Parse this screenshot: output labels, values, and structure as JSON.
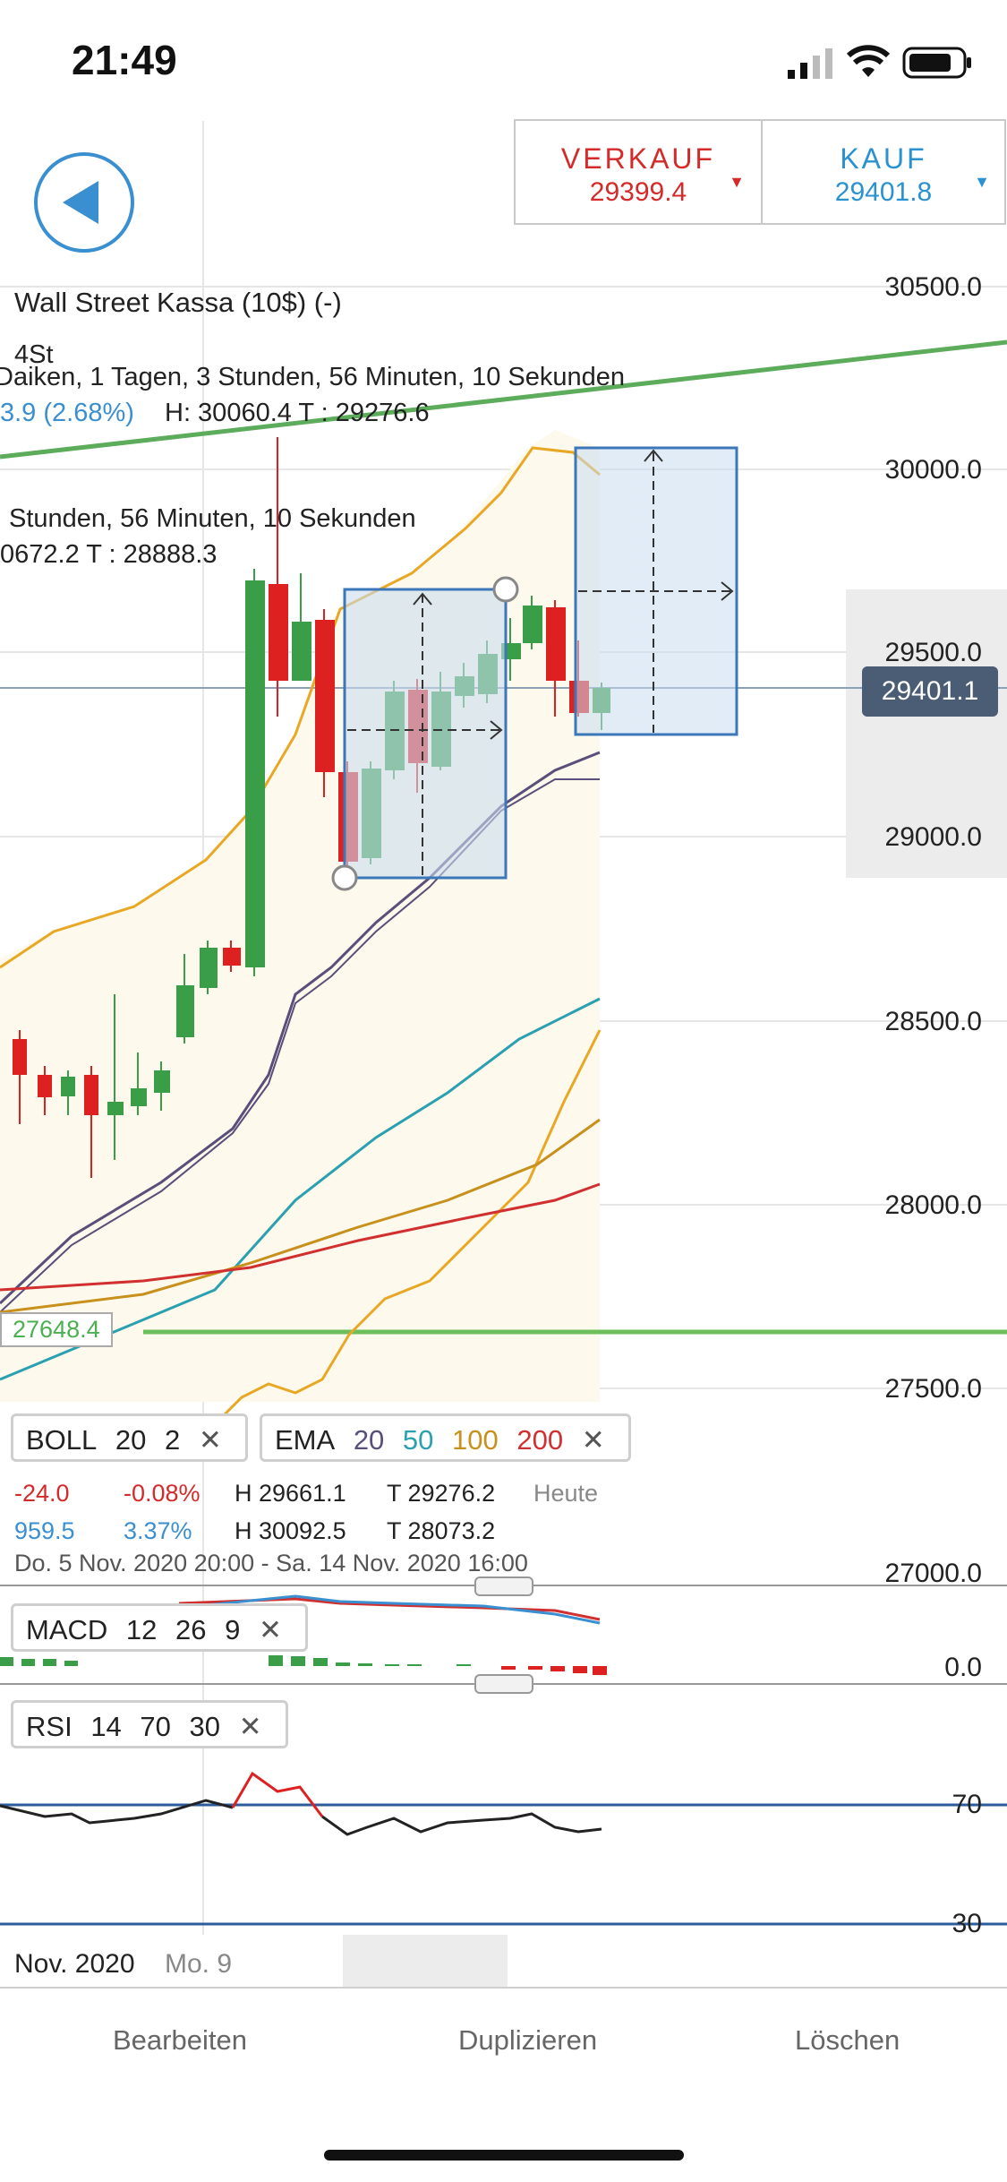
{
  "status": {
    "time": "21:49"
  },
  "trade": {
    "sell_label": "VERKAUF",
    "sell_price": "29399.4",
    "buy_label": "KAUF",
    "buy_price": "29401.8"
  },
  "instrument": {
    "name": "Wall Street Kassa (10$) (-)",
    "timeframe": "4St",
    "countdown_line": "Daiken, 1 Tagen, 3 Stunden, 56 Minuten, 10 Sekunden",
    "change_line_a": "3.9 (2.68%)",
    "change_line_b": "H: 30060.4 T : 29276.6",
    "countdown_line2": "Stunden, 56 Minuten, 10 Sekunden",
    "hl_line2": "0672.2 T : 28888.3"
  },
  "yaxis": {
    "ticks": [
      "30500.0",
      "30000.0",
      "29500.0",
      "29000.0",
      "28500.0",
      "28000.0",
      "27500.0",
      "27000.0"
    ],
    "current_price": "29401.1",
    "horizontal_level": "27648.4"
  },
  "indicators": {
    "boll": {
      "name": "BOLL",
      "p1": "20",
      "p2": "2"
    },
    "ema": {
      "name": "EMA",
      "p1": "20",
      "p2": "50",
      "p3": "100",
      "p4": "200"
    },
    "close_glyph": "✕"
  },
  "stats": {
    "chg": "-24.0",
    "chg_pct": "-0.08%",
    "high_a": "H 29661.1",
    "low_a": "T 29276.2",
    "period_a": "Heute",
    "val_b": "959.5",
    "pct_b": "3.37%",
    "high_b": "H 30092.5",
    "low_b": "T 28073.2",
    "range": "Do. 5 Nov. 2020 20:00 - Sa. 14 Nov. 2020 16:00"
  },
  "macd": {
    "name": "MACD",
    "p1": "12",
    "p2": "26",
    "p3": "9",
    "zero_label": "0.0"
  },
  "rsi": {
    "name": "RSI",
    "p1": "14",
    "p2": "70",
    "p3": "30",
    "upper": "70",
    "lower": "30"
  },
  "xaxis": {
    "label_a": "Nov. 2020",
    "label_b": "Mo. 9"
  },
  "toolbar": {
    "edit": "Bearbeiten",
    "duplicate": "Duplizieren",
    "delete": "Löschen"
  },
  "colors": {
    "up": "#3a9e48",
    "down": "#dd2020",
    "boll": "#e8a825",
    "ema20": "#5a4f7a",
    "ema50": "#2aa0b0",
    "ema100": "#c8901c",
    "ema200": "#d03030",
    "accent": "#3a8fd0"
  }
}
